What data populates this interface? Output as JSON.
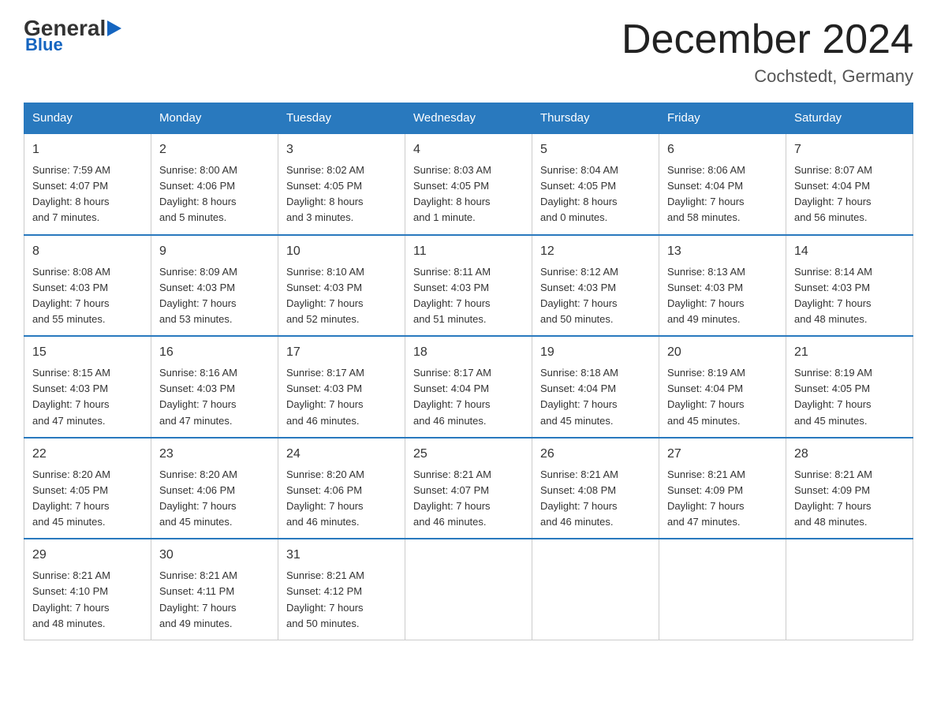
{
  "logo": {
    "general": "General",
    "blue": "Blue",
    "arrow_char": "▶"
  },
  "title": "December 2024",
  "location": "Cochstedt, Germany",
  "days_of_week": [
    "Sunday",
    "Monday",
    "Tuesday",
    "Wednesday",
    "Thursday",
    "Friday",
    "Saturday"
  ],
  "weeks": [
    [
      {
        "day": "1",
        "info": "Sunrise: 7:59 AM\nSunset: 4:07 PM\nDaylight: 8 hours\nand 7 minutes."
      },
      {
        "day": "2",
        "info": "Sunrise: 8:00 AM\nSunset: 4:06 PM\nDaylight: 8 hours\nand 5 minutes."
      },
      {
        "day": "3",
        "info": "Sunrise: 8:02 AM\nSunset: 4:05 PM\nDaylight: 8 hours\nand 3 minutes."
      },
      {
        "day": "4",
        "info": "Sunrise: 8:03 AM\nSunset: 4:05 PM\nDaylight: 8 hours\nand 1 minute."
      },
      {
        "day": "5",
        "info": "Sunrise: 8:04 AM\nSunset: 4:05 PM\nDaylight: 8 hours\nand 0 minutes."
      },
      {
        "day": "6",
        "info": "Sunrise: 8:06 AM\nSunset: 4:04 PM\nDaylight: 7 hours\nand 58 minutes."
      },
      {
        "day": "7",
        "info": "Sunrise: 8:07 AM\nSunset: 4:04 PM\nDaylight: 7 hours\nand 56 minutes."
      }
    ],
    [
      {
        "day": "8",
        "info": "Sunrise: 8:08 AM\nSunset: 4:03 PM\nDaylight: 7 hours\nand 55 minutes."
      },
      {
        "day": "9",
        "info": "Sunrise: 8:09 AM\nSunset: 4:03 PM\nDaylight: 7 hours\nand 53 minutes."
      },
      {
        "day": "10",
        "info": "Sunrise: 8:10 AM\nSunset: 4:03 PM\nDaylight: 7 hours\nand 52 minutes."
      },
      {
        "day": "11",
        "info": "Sunrise: 8:11 AM\nSunset: 4:03 PM\nDaylight: 7 hours\nand 51 minutes."
      },
      {
        "day": "12",
        "info": "Sunrise: 8:12 AM\nSunset: 4:03 PM\nDaylight: 7 hours\nand 50 minutes."
      },
      {
        "day": "13",
        "info": "Sunrise: 8:13 AM\nSunset: 4:03 PM\nDaylight: 7 hours\nand 49 minutes."
      },
      {
        "day": "14",
        "info": "Sunrise: 8:14 AM\nSunset: 4:03 PM\nDaylight: 7 hours\nand 48 minutes."
      }
    ],
    [
      {
        "day": "15",
        "info": "Sunrise: 8:15 AM\nSunset: 4:03 PM\nDaylight: 7 hours\nand 47 minutes."
      },
      {
        "day": "16",
        "info": "Sunrise: 8:16 AM\nSunset: 4:03 PM\nDaylight: 7 hours\nand 47 minutes."
      },
      {
        "day": "17",
        "info": "Sunrise: 8:17 AM\nSunset: 4:03 PM\nDaylight: 7 hours\nand 46 minutes."
      },
      {
        "day": "18",
        "info": "Sunrise: 8:17 AM\nSunset: 4:04 PM\nDaylight: 7 hours\nand 46 minutes."
      },
      {
        "day": "19",
        "info": "Sunrise: 8:18 AM\nSunset: 4:04 PM\nDaylight: 7 hours\nand 45 minutes."
      },
      {
        "day": "20",
        "info": "Sunrise: 8:19 AM\nSunset: 4:04 PM\nDaylight: 7 hours\nand 45 minutes."
      },
      {
        "day": "21",
        "info": "Sunrise: 8:19 AM\nSunset: 4:05 PM\nDaylight: 7 hours\nand 45 minutes."
      }
    ],
    [
      {
        "day": "22",
        "info": "Sunrise: 8:20 AM\nSunset: 4:05 PM\nDaylight: 7 hours\nand 45 minutes."
      },
      {
        "day": "23",
        "info": "Sunrise: 8:20 AM\nSunset: 4:06 PM\nDaylight: 7 hours\nand 45 minutes."
      },
      {
        "day": "24",
        "info": "Sunrise: 8:20 AM\nSunset: 4:06 PM\nDaylight: 7 hours\nand 46 minutes."
      },
      {
        "day": "25",
        "info": "Sunrise: 8:21 AM\nSunset: 4:07 PM\nDaylight: 7 hours\nand 46 minutes."
      },
      {
        "day": "26",
        "info": "Sunrise: 8:21 AM\nSunset: 4:08 PM\nDaylight: 7 hours\nand 46 minutes."
      },
      {
        "day": "27",
        "info": "Sunrise: 8:21 AM\nSunset: 4:09 PM\nDaylight: 7 hours\nand 47 minutes."
      },
      {
        "day": "28",
        "info": "Sunrise: 8:21 AM\nSunset: 4:09 PM\nDaylight: 7 hours\nand 48 minutes."
      }
    ],
    [
      {
        "day": "29",
        "info": "Sunrise: 8:21 AM\nSunset: 4:10 PM\nDaylight: 7 hours\nand 48 minutes."
      },
      {
        "day": "30",
        "info": "Sunrise: 8:21 AM\nSunset: 4:11 PM\nDaylight: 7 hours\nand 49 minutes."
      },
      {
        "day": "31",
        "info": "Sunrise: 8:21 AM\nSunset: 4:12 PM\nDaylight: 7 hours\nand 50 minutes."
      },
      {
        "day": "",
        "info": ""
      },
      {
        "day": "",
        "info": ""
      },
      {
        "day": "",
        "info": ""
      },
      {
        "day": "",
        "info": ""
      }
    ]
  ]
}
